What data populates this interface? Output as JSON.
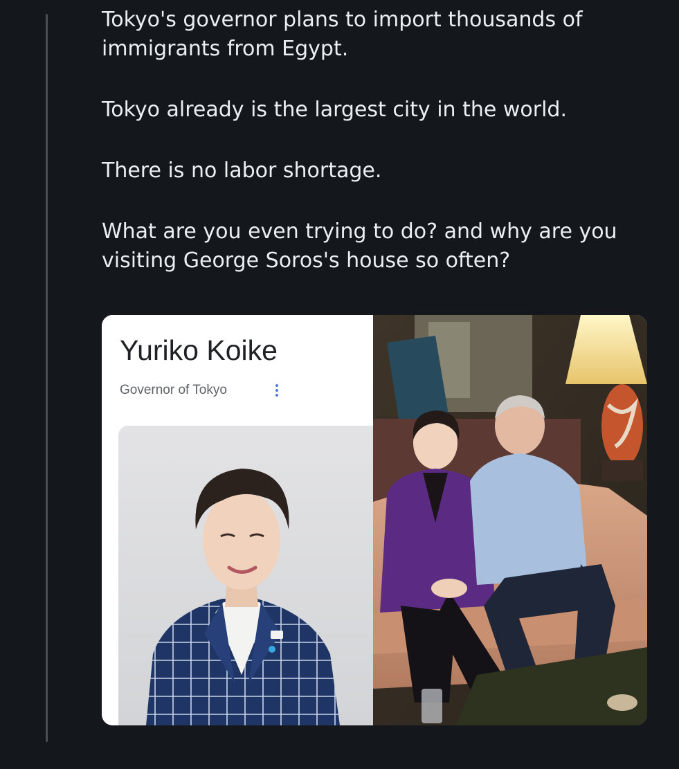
{
  "post": {
    "paragraphs": [
      "Tokyo's governor plans to import thousands of immigrants from Egypt.",
      "Tokyo already is the largest city in the world.",
      "There is no labor shortage.",
      "What are you even trying to do? and why are you visiting George Soros's house so often?"
    ]
  },
  "knowledge_card": {
    "name": "Yuriko Koike",
    "subtitle": "Governor of Tokyo",
    "more_icon": "vertical-dots-icon"
  },
  "colors": {
    "background": "#14171c",
    "text": "#eceff2",
    "thread_line": "#4a4f56",
    "card_title": "#202124",
    "card_subtitle": "#5f6368",
    "more_icon": "#4f7bd9"
  }
}
